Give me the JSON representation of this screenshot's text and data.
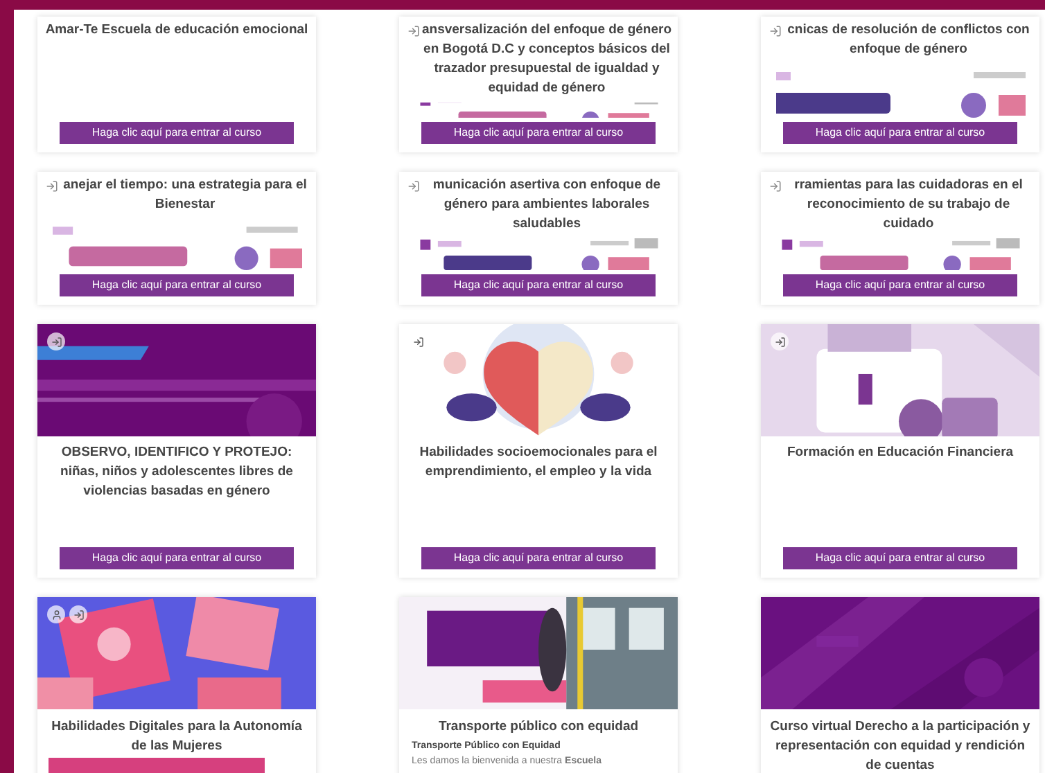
{
  "courses": [
    {
      "kind": "plain",
      "title": "Amar-Te Escuela de educación emocional",
      "title_icon": false,
      "button": {
        "label": "Haga clic aquí para entrar al curso",
        "color": "#7b3591"
      }
    },
    {
      "kind": "logos",
      "title": "ansversalización del enfoque de género en Bogotá D.C y conceptos básicos del trazador presupuestal de igualdad y equidad de género",
      "title_icon": true,
      "button": {
        "label": "Haga clic aquí para entrar al curso",
        "color": "#7b3591"
      }
    },
    {
      "kind": "logos",
      "title": "cnicas de resolución de conflictos con enfoque de género",
      "title_icon": true,
      "button": {
        "label": "Haga clic aquí para entrar al curso",
        "color": "#7b3591"
      }
    },
    {
      "kind": "logos",
      "title": "anejar el tiempo: una estrategia para el Bienestar",
      "title_icon": true,
      "button": {
        "label": "Haga clic aquí para entrar al curso",
        "color": "#7b3591"
      }
    },
    {
      "kind": "logos",
      "title": "municación asertiva con enfoque de género para ambientes laborales saludables",
      "title_icon": true,
      "button": {
        "label": "Haga clic aquí para entrar al curso",
        "color": "#7b3591"
      }
    },
    {
      "kind": "logos",
      "title": "rramientas para las cuidadoras en el reconocimiento de su trabajo de cuidado",
      "title_icon": true,
      "button": {
        "label": "Haga clic aquí para entrar al curso",
        "color": "#7b3591"
      }
    },
    {
      "kind": "cover",
      "title": "OBSERVO, IDENTIFICO Y PROTEJO: niñas, niños y adolescentes libres de violencias basadas en género",
      "login_icon": true,
      "user_icon": false,
      "button": {
        "label": "Haga clic aquí para entrar al curso",
        "color": "#7b3591"
      }
    },
    {
      "kind": "cover",
      "title": "Habilidades socioemocionales para el emprendimiento, el empleo y la vida",
      "login_icon": true,
      "user_icon": false,
      "button": {
        "label": "Haga clic aquí para entrar al curso",
        "color": "#7b3591"
      }
    },
    {
      "kind": "cover",
      "title": "Formación en Educación Financiera",
      "login_icon": true,
      "user_icon": false,
      "button": {
        "label": "Haga clic aquí para entrar al curso",
        "color": "#7b3591"
      }
    },
    {
      "kind": "cover",
      "title": "Habilidades Digitales para la Autonomía de las Mujeres",
      "login_icon": true,
      "user_icon": true,
      "button": {
        "color": "#d6407e"
      }
    },
    {
      "kind": "cover",
      "title": "Transporte público con equidad",
      "subtitle": "Transporte Público con Equidad",
      "description": "Les damos la bienvenida a nuestra **Escuela**",
      "login_icon": false,
      "user_icon": false
    },
    {
      "kind": "cover",
      "title": "Curso virtual Derecho a la participación y representación con equidad y rendición de cuentas",
      "login_icon": false,
      "user_icon": false
    }
  ]
}
